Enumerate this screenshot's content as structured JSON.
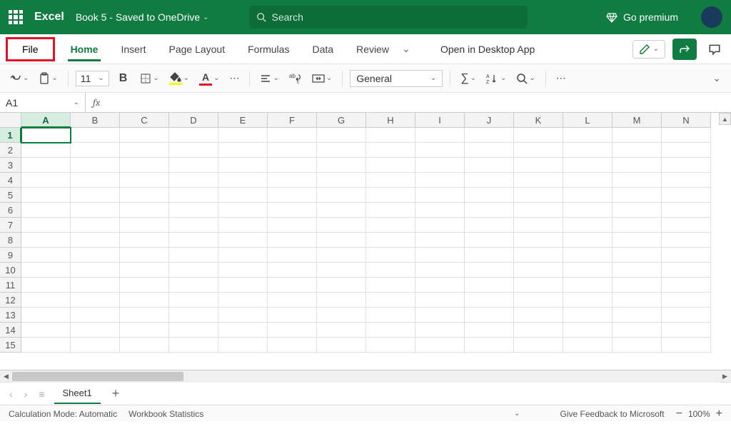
{
  "header": {
    "appName": "Excel",
    "docName": "Book 5  -  Saved to OneDrive",
    "searchPlaceholder": "Search",
    "premium": "Go premium"
  },
  "tabs": {
    "file": "File",
    "home": "Home",
    "insert": "Insert",
    "pageLayout": "Page Layout",
    "formulas": "Formulas",
    "data": "Data",
    "review": "Review",
    "desktop": "Open in Desktop App"
  },
  "toolbar": {
    "fontSize": "11",
    "numberFormat": "General"
  },
  "formula": {
    "nameBox": "A1",
    "value": ""
  },
  "grid": {
    "columns": [
      "A",
      "B",
      "C",
      "D",
      "E",
      "F",
      "G",
      "H",
      "I",
      "J",
      "K",
      "L",
      "M",
      "N"
    ],
    "rows": [
      "1",
      "2",
      "3",
      "4",
      "5",
      "6",
      "7",
      "8",
      "9",
      "10",
      "11",
      "12",
      "13",
      "14",
      "15"
    ],
    "activeCell": "A1",
    "selectedCol": "A",
    "selectedRow": "1"
  },
  "sheets": {
    "active": "Sheet1"
  },
  "status": {
    "calcMode": "Calculation Mode: Automatic",
    "workbookStats": "Workbook Statistics",
    "feedback": "Give Feedback to Microsoft",
    "zoom": "100%"
  }
}
